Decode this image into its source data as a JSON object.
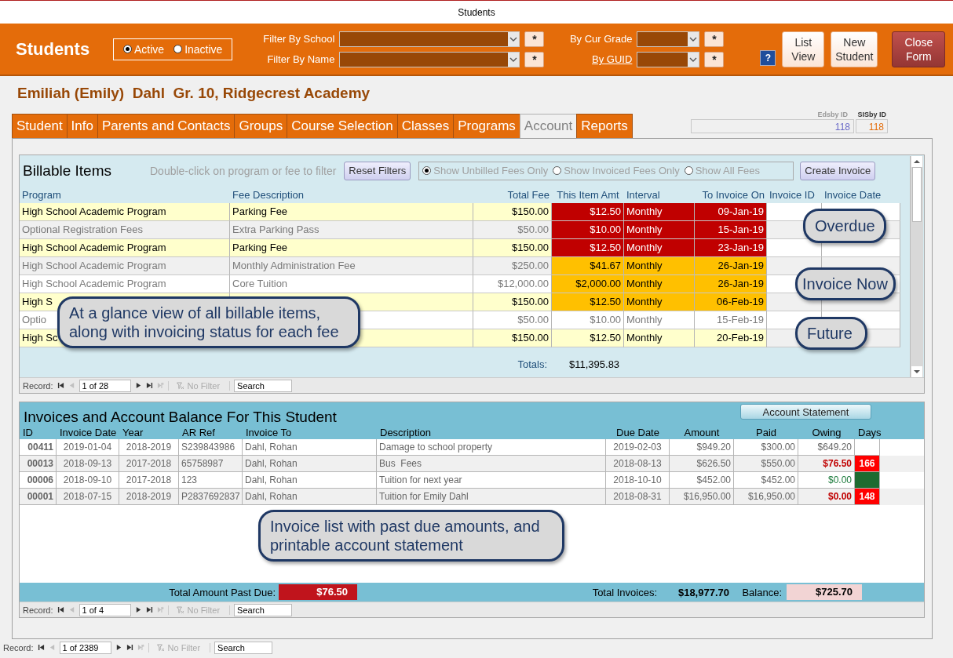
{
  "window": {
    "title": "Students"
  },
  "header": {
    "title": "Students",
    "status_options": [
      {
        "label": "Active",
        "selected": true
      },
      {
        "label": "Inactive",
        "selected": false
      }
    ],
    "filters": [
      {
        "label": "Filter By School",
        "kind": "label",
        "clear": "*"
      },
      {
        "label": "By Cur Grade",
        "kind": "label",
        "clear": "*"
      },
      {
        "label": "Filter By Name",
        "kind": "label",
        "clear": "*"
      },
      {
        "label": "By GUID",
        "kind": "link",
        "clear": "*"
      }
    ],
    "help": "?",
    "buttons": [
      {
        "label": "List View",
        "kind": "plain"
      },
      {
        "label": "New Student",
        "kind": "plain"
      },
      {
        "label": "Close Form",
        "kind": "close"
      }
    ]
  },
  "student_heading": "Emiliah (Emily)  Dahl  Gr. 10, Ridgecrest Academy",
  "tabs": [
    {
      "label": "Student",
      "selected": false
    },
    {
      "label": "Info",
      "selected": false
    },
    {
      "label": "Parents and Contacts",
      "selected": false
    },
    {
      "label": "Groups",
      "selected": false
    },
    {
      "label": "Course Selection",
      "selected": false
    },
    {
      "label": "Classes",
      "selected": false
    },
    {
      "label": "Programs",
      "selected": false
    },
    {
      "label": "Account",
      "selected": true
    },
    {
      "label": "Reports",
      "selected": false
    }
  ],
  "ids": [
    {
      "label": "Edsby ID",
      "value": "118",
      "color": "#6a6ac8"
    },
    {
      "label": "SISby ID",
      "value": "118",
      "color": "#e46c0a"
    }
  ],
  "billable": {
    "title": "Billable Items",
    "hint": "Double-click on program or fee to filter",
    "reset_button": "Reset Filters",
    "fee_filters": [
      {
        "label": "Show Unbilled Fees Only",
        "selected": true
      },
      {
        "label": "Show Invoiced Fees Only",
        "selected": false
      },
      {
        "label": "Show All Fees",
        "selected": false
      }
    ],
    "create_button": "Create Invoice",
    "columns": [
      "Program",
      "Fee Description",
      "Total Fee",
      "This Item Amt",
      "Interval",
      "To Invoice On",
      "Invoice ID",
      "Invoice Date"
    ],
    "rows": [
      {
        "program": "High School Academic Program",
        "fee": "Parking Fee",
        "total": "$150.00",
        "amount": "$12.50",
        "interval": "Monthly",
        "invoice_on": "09-Jan-19",
        "kind": "overdue",
        "emphasized": true
      },
      {
        "program": "Optional Registration Fees",
        "fee": "Extra Parking Pass",
        "total": "$50.00",
        "amount": "$10.00",
        "interval": "Monthly",
        "invoice_on": "15-Jan-19",
        "kind": "overdue",
        "emphasized": false
      },
      {
        "program": "High School Academic Program",
        "fee": "Parking Fee",
        "total": "$150.00",
        "amount": "$12.50",
        "interval": "Monthly",
        "invoice_on": "23-Jan-19",
        "kind": "overdue",
        "emphasized": true
      },
      {
        "program": "High School Academic Program",
        "fee": "Monthly Administration Fee",
        "total": "$250.00",
        "amount": "$41.67",
        "interval": "Monthly",
        "invoice_on": "26-Jan-19",
        "kind": "due",
        "emphasized": false
      },
      {
        "program": "High School Academic Program",
        "fee": "Core Tuition",
        "total": "$12,000.00",
        "amount": "$2,000.00",
        "interval": "Monthly",
        "invoice_on": "26-Jan-19",
        "kind": "due",
        "emphasized": false
      },
      {
        "program": "High S",
        "total": "$150.00",
        "amount": "$12.50",
        "interval": "Monthly",
        "invoice_on": "06-Feb-19",
        "kind": "due",
        "emphasized": true
      },
      {
        "program": "Optio",
        "total": "$50.00",
        "amount": "$10.00",
        "interval": "Monthly",
        "invoice_on": "15-Feb-19",
        "kind": "future",
        "emphasized": false
      },
      {
        "program": "High Sc",
        "total": "$150.00",
        "amount": "$12.50",
        "interval": "Monthly",
        "invoice_on": "20-Feb-19",
        "kind": "future",
        "emphasized": true
      }
    ],
    "totals_label": "Totals:",
    "total": "$11,395.83",
    "callouts": [
      "At a glance view of all billable items, along with invoicing status for each fee",
      "Overdue",
      "Invoice Now",
      "Future"
    ],
    "navigation": {
      "record_label": "Record:",
      "position": "1 of 28",
      "filter": "No Filter",
      "search": "Search"
    }
  },
  "invoices": {
    "title": "Invoices and Account Balance For This Student",
    "statement_button": "Account Statement",
    "columns": [
      "ID",
      "Invoice Date",
      "Year",
      "AR Ref",
      "Invoice To",
      "Description",
      "Due Date",
      "Amount",
      "Paid",
      "Owing",
      "Days"
    ],
    "rows": [
      {
        "id": "00411",
        "date": "2019-01-04",
        "year": "2018-2019",
        "ar_ref": "S239843986",
        "to": "Dahl, Rohan",
        "description": "Damage to school property",
        "due": "2019-02-03",
        "amount": "$949.20",
        "paid": "$300.00",
        "owing": "$649.20",
        "kind": "open"
      },
      {
        "id": "00013",
        "date": "2018-09-13",
        "year": "2017-2018",
        "ar_ref": "65758987",
        "to": "Dahl, Rohan",
        "description": "Bus  Fees",
        "due": "2018-08-13",
        "amount": "$626.50",
        "paid": "$550.00",
        "owing": "$76.50",
        "days": "166",
        "kind": "overdue"
      },
      {
        "id": "00006",
        "date": "2018-09-10",
        "year": "2017-2018",
        "ar_ref": "123",
        "to": "Dahl, Rohan",
        "description": "Tuition for next year",
        "due": "2018-10-10",
        "amount": "$452.00",
        "paid": "$452.00",
        "owing": "$0.00",
        "kind": "paid"
      },
      {
        "id": "00001",
        "date": "2018-07-15",
        "year": "2018-2019",
        "ar_ref": "P2837692837",
        "to": "Dahl, Rohan",
        "description": "Tuition for Emily Dahl",
        "due": "2018-08-31",
        "amount": "$16,950.00",
        "paid": "$16,950.00",
        "owing": "$0.00",
        "days": "148",
        "kind": "overdue"
      }
    ],
    "callouts": [
      "Invoice list with past due amounts, and printable account statement"
    ],
    "past_due_label": "Total Amount Past Due:",
    "past_due": "$76.50",
    "total_label": "Total Invoices:",
    "total": "$18,977.70",
    "balance_label": "Balance:",
    "balance": "$725.70",
    "navigation": {
      "record_label": "Record:",
      "position": "1 of 4",
      "filter": "No Filter",
      "search": "Search"
    }
  },
  "navigation": {
    "record_label": "Record:",
    "position": "1 of 2389",
    "filter": "No Filter",
    "search": "Search"
  }
}
